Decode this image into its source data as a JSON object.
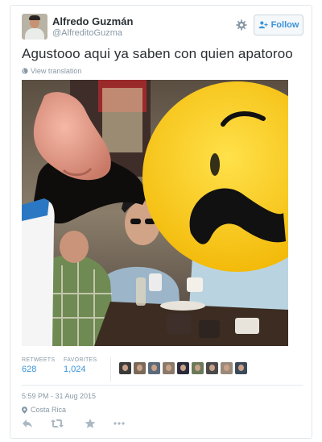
{
  "user": {
    "name": "Alfredo Guzmán",
    "handle": "@AlfreditoGuzma"
  },
  "follow_label": "Follow",
  "tweet": {
    "text": "Agustooo aqui ya saben con quien apatoroo",
    "translate_label": "View translation"
  },
  "stats": {
    "retweets_label": "RETWEETS",
    "retweets_value": "628",
    "favorites_label": "FAVORITES",
    "favorites_value": "1,024"
  },
  "timestamp": "5:59 PM - 31 Aug 2015",
  "location": "Costa Rica",
  "colors": {
    "link": "#3b94d9",
    "muted": "#8899a6",
    "emoji": "#fcd116"
  },
  "icons": [
    "gear-icon",
    "follow-person-icon",
    "globe-icon",
    "location-pin-icon",
    "reply-icon",
    "retweet-icon",
    "favorite-star-icon",
    "more-dots-icon"
  ]
}
